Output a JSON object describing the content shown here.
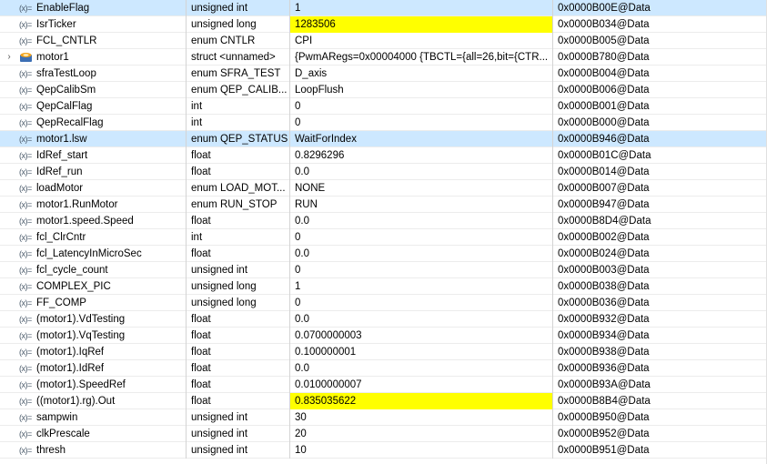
{
  "rows": [
    {
      "name": "EnableFlag",
      "type": "unsigned int",
      "value": "1",
      "address": "0x0000B00E@Data",
      "icon": "variable-icon",
      "highlight": false,
      "expandable": false,
      "selected": true
    },
    {
      "name": "IsrTicker",
      "type": "unsigned long",
      "value": "1283506",
      "address": "0x0000B034@Data",
      "icon": "variable-icon",
      "highlight": true,
      "expandable": false,
      "selected": false
    },
    {
      "name": "FCL_CNTLR",
      "type": "enum CNTLR",
      "value": "CPI",
      "address": "0x0000B005@Data",
      "icon": "variable-icon",
      "highlight": false,
      "expandable": false,
      "selected": false
    },
    {
      "name": "motor1",
      "type": "struct <unnamed>",
      "value": "{PwmARegs=0x00004000 {TBCTL={all=26,bit={CTR...",
      "address": "0x0000B780@Data",
      "icon": "struct-icon",
      "highlight": false,
      "expandable": true,
      "selected": false
    },
    {
      "name": "sfraTestLoop",
      "type": "enum SFRA_TEST",
      "value": "D_axis",
      "address": "0x0000B004@Data",
      "icon": "variable-icon",
      "highlight": false,
      "expandable": false,
      "selected": false
    },
    {
      "name": "QepCalibSm",
      "type": "enum QEP_CALIB...",
      "value": "LoopFlush",
      "address": "0x0000B006@Data",
      "icon": "variable-icon",
      "highlight": false,
      "expandable": false,
      "selected": false
    },
    {
      "name": "QepCalFlag",
      "type": "int",
      "value": "0",
      "address": "0x0000B001@Data",
      "icon": "variable-icon",
      "highlight": false,
      "expandable": false,
      "selected": false
    },
    {
      "name": "QepRecalFlag",
      "type": "int",
      "value": "0",
      "address": "0x0000B000@Data",
      "icon": "variable-icon",
      "highlight": false,
      "expandable": false,
      "selected": false
    },
    {
      "name": "motor1.lsw",
      "type": "enum QEP_STATUS",
      "value": "WaitForIndex",
      "address": "0x0000B946@Data",
      "icon": "variable-icon",
      "highlight": false,
      "expandable": false,
      "selected": true
    },
    {
      "name": "IdRef_start",
      "type": "float",
      "value": "0.8296296",
      "address": "0x0000B01C@Data",
      "icon": "variable-icon",
      "highlight": false,
      "expandable": false,
      "selected": false
    },
    {
      "name": "IdRef_run",
      "type": "float",
      "value": "0.0",
      "address": "0x0000B014@Data",
      "icon": "variable-icon",
      "highlight": false,
      "expandable": false,
      "selected": false
    },
    {
      "name": "loadMotor",
      "type": "enum LOAD_MOT...",
      "value": "NONE",
      "address": "0x0000B007@Data",
      "icon": "variable-icon",
      "highlight": false,
      "expandable": false,
      "selected": false
    },
    {
      "name": "motor1.RunMotor",
      "type": "enum RUN_STOP",
      "value": "RUN",
      "address": "0x0000B947@Data",
      "icon": "variable-icon",
      "highlight": false,
      "expandable": false,
      "selected": false
    },
    {
      "name": "motor1.speed.Speed",
      "type": "float",
      "value": "0.0",
      "address": "0x0000B8D4@Data",
      "icon": "variable-icon",
      "highlight": false,
      "expandable": false,
      "selected": false
    },
    {
      "name": "fcl_ClrCntr",
      "type": "int",
      "value": "0",
      "address": "0x0000B002@Data",
      "icon": "variable-icon",
      "highlight": false,
      "expandable": false,
      "selected": false
    },
    {
      "name": "fcl_LatencyInMicroSec",
      "type": "float",
      "value": "0.0",
      "address": "0x0000B024@Data",
      "icon": "variable-icon",
      "highlight": false,
      "expandable": false,
      "selected": false
    },
    {
      "name": "fcl_cycle_count",
      "type": "unsigned int",
      "value": "0",
      "address": "0x0000B003@Data",
      "icon": "variable-icon",
      "highlight": false,
      "expandable": false,
      "selected": false
    },
    {
      "name": "COMPLEX_PIC",
      "type": "unsigned long",
      "value": "1",
      "address": "0x0000B038@Data",
      "icon": "variable-icon",
      "highlight": false,
      "expandable": false,
      "selected": false
    },
    {
      "name": "FF_COMP",
      "type": "unsigned long",
      "value": "0",
      "address": "0x0000B036@Data",
      "icon": "variable-icon",
      "highlight": false,
      "expandable": false,
      "selected": false
    },
    {
      "name": "(motor1).VdTesting",
      "type": "float",
      "value": "0.0",
      "address": "0x0000B932@Data",
      "icon": "variable-icon",
      "highlight": false,
      "expandable": false,
      "selected": false
    },
    {
      "name": "(motor1).VqTesting",
      "type": "float",
      "value": "0.0700000003",
      "address": "0x0000B934@Data",
      "icon": "variable-icon",
      "highlight": false,
      "expandable": false,
      "selected": false
    },
    {
      "name": "(motor1).IqRef",
      "type": "float",
      "value": "0.100000001",
      "address": "0x0000B938@Data",
      "icon": "variable-icon",
      "highlight": false,
      "expandable": false,
      "selected": false
    },
    {
      "name": "(motor1).IdRef",
      "type": "float",
      "value": "0.0",
      "address": "0x0000B936@Data",
      "icon": "variable-icon",
      "highlight": false,
      "expandable": false,
      "selected": false
    },
    {
      "name": "(motor1).SpeedRef",
      "type": "float",
      "value": "0.0100000007",
      "address": "0x0000B93A@Data",
      "icon": "variable-icon",
      "highlight": false,
      "expandable": false,
      "selected": false
    },
    {
      "name": "((motor1).rg).Out",
      "type": "float",
      "value": "0.835035622",
      "address": "0x0000B8B4@Data",
      "icon": "variable-icon",
      "highlight": true,
      "expandable": false,
      "selected": false
    },
    {
      "name": "sampwin",
      "type": "unsigned int",
      "value": "30",
      "address": "0x0000B950@Data",
      "icon": "variable-icon",
      "highlight": false,
      "expandable": false,
      "selected": false
    },
    {
      "name": "clkPrescale",
      "type": "unsigned int",
      "value": "20",
      "address": "0x0000B952@Data",
      "icon": "variable-icon",
      "highlight": false,
      "expandable": false,
      "selected": false
    },
    {
      "name": "thresh",
      "type": "unsigned int",
      "value": "10",
      "address": "0x0000B951@Data",
      "icon": "variable-icon",
      "highlight": false,
      "expandable": false,
      "selected": false
    }
  ],
  "icons": {
    "variable_glyph": "(x)=",
    "expand_glyph": "›"
  },
  "colors": {
    "highlight": "#ffff00",
    "selected": "#cde8ff"
  }
}
